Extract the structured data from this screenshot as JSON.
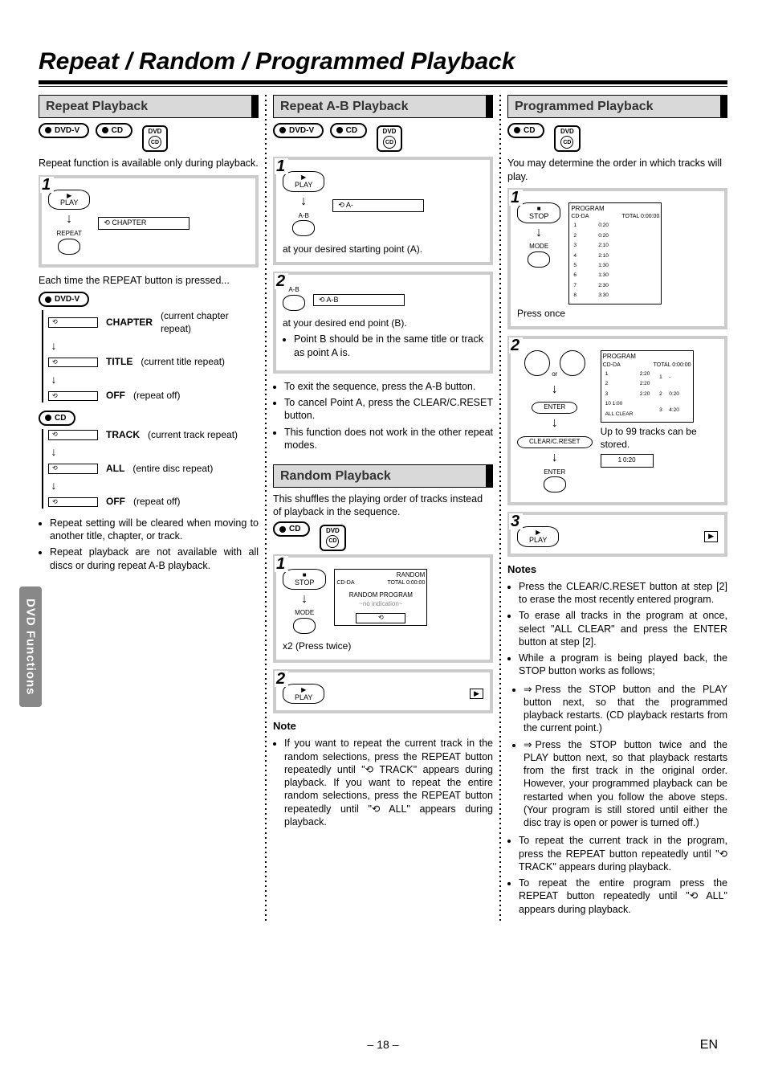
{
  "page": {
    "title": "Repeat / Random / Programmed Playback",
    "side_tab": "DVD Functions",
    "page_number": "– 18 –",
    "lang": "EN"
  },
  "badges": {
    "dvdv": "DVD-V",
    "cd": "CD",
    "dvd_vcd": "DVD VIDEO CD"
  },
  "col1": {
    "heading": "Repeat Playback",
    "intro": "Repeat function is available only during playback.",
    "step1": {
      "btn_play_top": "▶",
      "btn_play": "PLAY",
      "btn_repeat": "REPEAT",
      "osd": "⟲  CHAPTER"
    },
    "each_time": "Each time the REPEAT button is pressed...",
    "dvd_cycle": [
      {
        "icon": "⟲",
        "label": "CHAPTER",
        "desc": "(current chapter repeat)"
      },
      {
        "icon": "⟲",
        "label": "TITLE",
        "desc": "(current title repeat)"
      },
      {
        "icon": "⟲",
        "label": "OFF",
        "desc": "(repeat off)"
      }
    ],
    "cd_cycle": [
      {
        "icon": "⟲",
        "label": "TRACK",
        "desc": "(current track repeat)"
      },
      {
        "icon": "⟲",
        "label": "ALL",
        "desc": "(entire disc repeat)"
      },
      {
        "icon": "⟲",
        "label": "OFF",
        "desc": "(repeat off)"
      }
    ],
    "notes": [
      "Repeat setting will be cleared when moving to another title, chapter, or track.",
      "Repeat playback are not available with all discs or during repeat A-B playback."
    ]
  },
  "col2a": {
    "heading": "Repeat A-B Playback",
    "step1": {
      "btn_play_top": "▶",
      "btn_play": "PLAY",
      "btn_ab": "A-B",
      "osd": "⟲  A-",
      "caption": "at your desired starting point (A)."
    },
    "step2": {
      "btn_ab": "A-B",
      "osd": "⟲  A-B",
      "caption": "at your desired end point (B).",
      "bullet": "Point B should be in the same title or track as point A is."
    },
    "notes": [
      "To exit the sequence, press the A-B button.",
      "To cancel Point A, press the CLEAR/C.RESET button.",
      "This function does not work in the other repeat modes."
    ]
  },
  "col2b": {
    "heading": "Random Playback",
    "intro": "This shuffles the playing order of tracks instead of playback in the sequence.",
    "step1": {
      "btn_stop_top": "■",
      "btn_stop": "STOP",
      "btn_mode": "MODE",
      "caption": "x2 (Press twice)",
      "osd_title": "RANDOM",
      "osd_sub1": "CD-DA",
      "osd_sub2": "TOTAL 0:00:00",
      "osd_mid": "RANDOM PROGRAM",
      "osd_hint": "~no indication~"
    },
    "step2": {
      "btn_play_top": "▶",
      "btn_play": "PLAY",
      "play_icon": "▶"
    },
    "note_head": "Note",
    "note": "If you want to repeat the current track in the random selections, press the REPEAT button repeatedly until \"⟲ TRACK\" appears during playback. If you want to repeat the entire random selections, press the REPEAT button repeatedly until \"⟲ ALL\" appears during playback."
  },
  "col3": {
    "heading": "Programmed Playback",
    "intro": "You may determine the order in which tracks will play.",
    "step1": {
      "btn_stop_top": "■",
      "btn_stop": "STOP",
      "btn_mode": "MODE",
      "caption": "Press once",
      "screen_title": "PROGRAM",
      "screen_sub": "CD-DA",
      "screen_total": "TOTAL 0:00:00",
      "rows": [
        [
          "1",
          "0:20"
        ],
        [
          "2",
          "0:20"
        ],
        [
          "3",
          "2:10"
        ],
        [
          "4",
          "2:10"
        ],
        [
          "5",
          "1:30"
        ],
        [
          "6",
          "1:30"
        ],
        [
          "7",
          "2:30"
        ],
        [
          "8",
          "3:30"
        ]
      ]
    },
    "step2": {
      "btn_enter": "ENTER",
      "btn_clear": "CLEAR/C.RESET",
      "caption": "Up to 99 tracks can be stored.",
      "screen_title": "PROGRAM",
      "screen_sub": "CD-DA",
      "screen_total": "TOTAL 0:00:00",
      "left_rows": [
        [
          "1",
          "2:20"
        ],
        [
          "2",
          "2:20"
        ],
        [
          "3",
          "2:20"
        ],
        [
          "10 1:00",
          ""
        ],
        [
          "ALL CLEAR",
          ""
        ]
      ],
      "right_rows": [
        [
          "1",
          "-"
        ],
        [
          "2",
          "0:20"
        ],
        [
          "3",
          "4:20"
        ]
      ],
      "footer_row": [
        "1",
        "0:20"
      ]
    },
    "step3": {
      "btn_play_top": "▶",
      "btn_play": "PLAY",
      "play_icon": "▶"
    },
    "notes_head": "Notes",
    "notes": [
      "Press the CLEAR/C.RESET button at step [2] to erase the most recently entered program.",
      "To erase all tracks in the program at once, select \"ALL CLEAR\" and press the ENTER button at step [2].",
      "While a program is being played back, the STOP button works as follows;"
    ],
    "sub_notes": [
      "Press the STOP button and the PLAY button next, so that the programmed playback restarts. (CD playback restarts from the current point.)",
      "Press the STOP button twice and the PLAY button next, so that playback restarts from the first track in the original order. However, your programmed playback can be restarted when you follow the above steps. (Your program is still stored until either the disc tray is open or power is turned off.)"
    ],
    "notes_tail": [
      "To repeat the current track in the program, press the REPEAT button repeatedly until \"⟲ TRACK\" appears during playback.",
      "To repeat the entire program press the REPEAT button repeatedly until \"⟲ ALL\" appears during playback."
    ]
  }
}
